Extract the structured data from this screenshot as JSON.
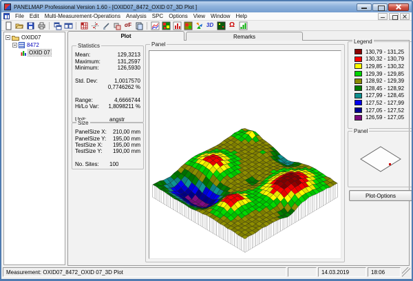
{
  "window": {
    "title": "PANELMAP  Professional Version 1.60 - [OXID07_8472_OXID 07_3D Plot ]"
  },
  "menu": {
    "items": [
      "File",
      "Edit",
      "Multi-Measurement-Operations",
      "Analysis",
      "SPC",
      "Options",
      "View",
      "Window",
      "Help"
    ]
  },
  "toolbar": {
    "sigma_f_label": "σF",
    "threed_label": "3D",
    "omega_label": "Ω"
  },
  "tree": {
    "items": [
      {
        "label": "OXID07"
      },
      {
        "label": "8472"
      },
      {
        "label": "OXID 07"
      }
    ]
  },
  "tabs": {
    "plot": "Plot",
    "remarks": "Remarks"
  },
  "statistics": {
    "title": "Statistics",
    "rows": [
      {
        "label": "Mean:",
        "value": "129,3213",
        "cls": ""
      },
      {
        "label": "Maximum:",
        "value": "131,2597",
        "cls": ""
      },
      {
        "label": "Minimum:",
        "value": "126,5930",
        "cls": ""
      },
      {
        "label": "",
        "value": "",
        "cls": ""
      },
      {
        "label": "Std. Dev:",
        "value": "1,0017570",
        "cls": ""
      },
      {
        "label": "",
        "value": "0,7746262 %",
        "cls": ""
      },
      {
        "label": "",
        "value": "",
        "cls": ""
      },
      {
        "label": "Range:",
        "value": "4,6666744",
        "cls": ""
      },
      {
        "label": "Hi/Lo Var:",
        "value": "1,8098211 %",
        "cls": ""
      },
      {
        "label": "",
        "value": "",
        "cls": ""
      },
      {
        "label": "Unit:",
        "value": "angstr",
        "cls": "val-left"
      }
    ]
  },
  "size": {
    "title": "Size",
    "rows": [
      {
        "label": "PanelSize X:",
        "value": "210,00 mm",
        "cls": ""
      },
      {
        "label": "PanelSize Y:",
        "value": "195,00 mm",
        "cls": ""
      },
      {
        "label": "TestSize X:",
        "value": "195,00 mm",
        "cls": ""
      },
      {
        "label": "TestSize Y:",
        "value": "190,00 mm",
        "cls": ""
      },
      {
        "label": "",
        "value": "",
        "cls": ""
      },
      {
        "label": "No. Sites:",
        "value": "100",
        "cls": "val-left"
      }
    ]
  },
  "panel_main": {
    "title": "Panel"
  },
  "legend": {
    "title": "Legend",
    "entries": [
      {
        "range": "130,79 - 131,25",
        "color": "#8b0000"
      },
      {
        "range": "130,32 - 130,79",
        "color": "#fe0000"
      },
      {
        "range": "129,85 - 130,32",
        "color": "#ffff00"
      },
      {
        "range": "129,39 - 129,85",
        "color": "#00d400"
      },
      {
        "range": "128,92 - 129,39",
        "color": "#8a8a00"
      },
      {
        "range": "128,45 - 128,92",
        "color": "#007a00"
      },
      {
        "range": "127,99 - 128,45",
        "color": "#0e8f8f"
      },
      {
        "range": "127,52 - 127,99",
        "color": "#0000ee"
      },
      {
        "range": "127,05 - 127,52",
        "color": "#000090"
      },
      {
        "range": "126,59 - 127,05",
        "color": "#7d0c7d"
      }
    ]
  },
  "panel_right": {
    "title": "Panel"
  },
  "plot_options_label": "Plot-Options",
  "status": {
    "measurement": "Measurement: OXID07_8472_OXID 07_3D Plot",
    "date": "14.03.2019",
    "time": "18:06"
  },
  "chart_data": {
    "type": "heatmap",
    "representation": "3d-surface-mesh",
    "title": "OXID07_8472_OXID 07_3D Plot",
    "unit": "angstr",
    "value_range": [
      126.59,
      131.25
    ],
    "stats": {
      "mean": 129.3213,
      "maximum": 131.2597,
      "minimum": 126.593,
      "std_dev": 1.001757,
      "range": 4.6666744,
      "no_sites": 100
    },
    "bands": [
      {
        "min": 130.79,
        "max": 131.25,
        "color": "#8b0000"
      },
      {
        "min": 130.32,
        "max": 130.79,
        "color": "#fe0000"
      },
      {
        "min": 129.85,
        "max": 130.32,
        "color": "#ffff00"
      },
      {
        "min": 129.39,
        "max": 129.85,
        "color": "#00d400"
      },
      {
        "min": 128.92,
        "max": 129.39,
        "color": "#8a8a00"
      },
      {
        "min": 128.45,
        "max": 128.92,
        "color": "#007a00"
      },
      {
        "min": 127.99,
        "max": 128.45,
        "color": "#0e8f8f"
      },
      {
        "min": 127.52,
        "max": 127.99,
        "color": "#0000ee"
      },
      {
        "min": 127.05,
        "max": 127.52,
        "color": "#000090"
      },
      {
        "min": 126.59,
        "max": 127.05,
        "color": "#7d0c7d"
      }
    ],
    "grid": {
      "n": 26,
      "base": 129.12,
      "noise": 0.09,
      "bumps": [
        [
          0.18,
          0.55,
          1.6,
          0.11,
          0.13
        ],
        [
          0.3,
          0.8,
          -2.6,
          0.16,
          0.1
        ],
        [
          0.62,
          0.78,
          2.0,
          0.09,
          0.1
        ],
        [
          0.8,
          0.32,
          2.1,
          0.12,
          0.16
        ],
        [
          0.45,
          0.02,
          -1.1,
          0.1,
          0.07
        ],
        [
          0.97,
          0.52,
          -1.0,
          0.06,
          0.07
        ],
        [
          0.06,
          0.1,
          0.5,
          0.07,
          0.07
        ],
        [
          0.12,
          0.04,
          0.85,
          0.03,
          0.03
        ],
        [
          0.52,
          0.42,
          -0.6,
          0.05,
          0.05
        ],
        [
          0.33,
          0.1,
          0.55,
          0.06,
          0.06
        ],
        [
          0.1,
          0.86,
          -0.5,
          0.07,
          0.07
        ]
      ]
    },
    "projection": {
      "ox": 140,
      "oy": 153,
      "w": 5.2,
      "h": 3.1,
      "zscale": 8.5,
      "zbase": 124.3,
      "base_plane": 126.8
    }
  }
}
